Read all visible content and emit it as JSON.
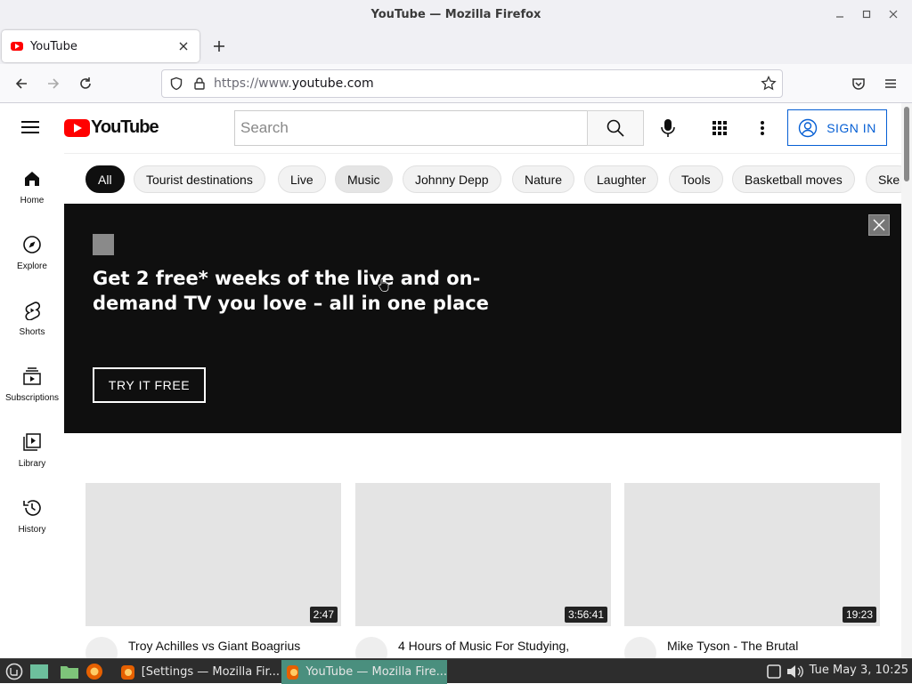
{
  "window": {
    "title": "YouTube — Mozilla Firefox"
  },
  "browser": {
    "tab_title": "YouTube",
    "url_proto": "https://www.",
    "url_host": "youtube.com"
  },
  "header": {
    "logo_text": "YouTube",
    "search_placeholder": "Search",
    "signin_label": "SIGN IN"
  },
  "sidebar": {
    "items": [
      {
        "label": "Home",
        "icon": "home-icon"
      },
      {
        "label": "Explore",
        "icon": "compass-icon"
      },
      {
        "label": "Shorts",
        "icon": "shorts-icon"
      },
      {
        "label": "Subscriptions",
        "icon": "subscriptions-icon"
      },
      {
        "label": "Library",
        "icon": "library-icon"
      },
      {
        "label": "History",
        "icon": "history-icon"
      }
    ]
  },
  "chips": [
    "All",
    "Tourist destinations",
    "Live",
    "Music",
    "Johnny Depp",
    "Nature",
    "Laughter",
    "Tools",
    "Basketball moves",
    "Ske"
  ],
  "promo": {
    "headline": "Get 2 free* weeks of the live and on-demand TV you love – all in one place",
    "cta": "TRY IT FREE"
  },
  "videos": [
    {
      "duration": "2:47",
      "title": "Troy Achilles vs Giant Boagrius"
    },
    {
      "duration": "3:56:41",
      "title": "4 Hours of Music For Studying,"
    },
    {
      "duration": "19:23",
      "title": "Mike Tyson - The Brutal"
    }
  ],
  "taskbar": {
    "tasks": [
      {
        "label": "[Settings — Mozilla Fir...",
        "active": false
      },
      {
        "label": "YouTube — Mozilla Fire...",
        "active": true
      }
    ],
    "clock": "Tue May  3, 10:25"
  },
  "colors": {
    "youtube_red": "#ff0000",
    "signin_blue": "#065fd4",
    "active_task": "#4a8f7e"
  }
}
